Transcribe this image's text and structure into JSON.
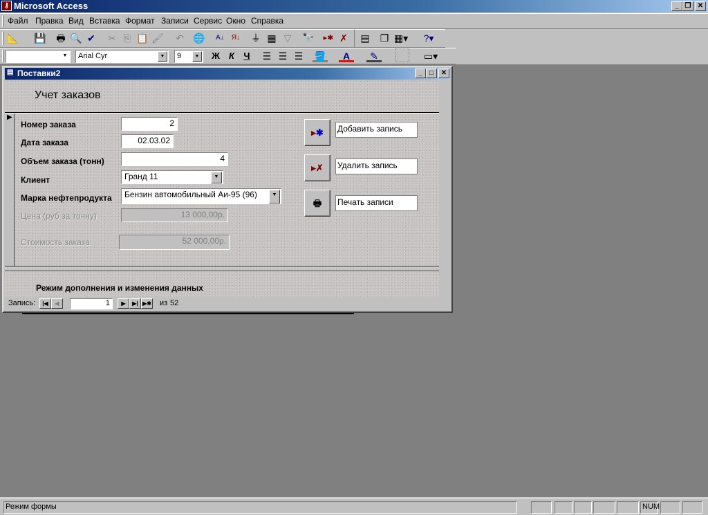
{
  "app": {
    "title": "Microsoft Access",
    "window_buttons": [
      "_",
      "❐",
      "✕"
    ]
  },
  "menu": [
    "Файл",
    "Правка",
    "Вид",
    "Вставка",
    "Формат",
    "Записи",
    "Сервис",
    "Окно",
    "Справка"
  ],
  "format_bar": {
    "style_value": "",
    "font_value": "Arial Cyr",
    "size_value": "9",
    "bold": "Ж",
    "italic": "К",
    "underline": "Ч"
  },
  "form": {
    "window_title": "Поставки2",
    "header": "Учет заказов",
    "fields": {
      "order_number": {
        "label": "Номер заказа",
        "value": "2"
      },
      "order_date": {
        "label": "Дата заказа",
        "value": "02.03.02"
      },
      "volume": {
        "label": "Объем заказа (тонн)",
        "value": "4"
      },
      "client": {
        "label": "Клиент",
        "value": "Гранд 11"
      },
      "product": {
        "label": "Марка нефтепродукта",
        "value": "Бензин автомобильный Аи-95 (96)"
      },
      "price": {
        "label": "Цена (руб за тонну)",
        "value": "13 000,00р."
      },
      "cost": {
        "label": "Стоимость заказа",
        "value": "52 000,00р."
      }
    },
    "buttons": {
      "add": "Добавить запись",
      "delete": "Удалить запись",
      "print": "Печать записи"
    },
    "footer": "Режим дополнения и изменения данных",
    "nav": {
      "label": "Запись:",
      "current": "1",
      "of": "из",
      "total": "52"
    }
  },
  "status": {
    "text": "Режим формы",
    "num": "NUM"
  }
}
